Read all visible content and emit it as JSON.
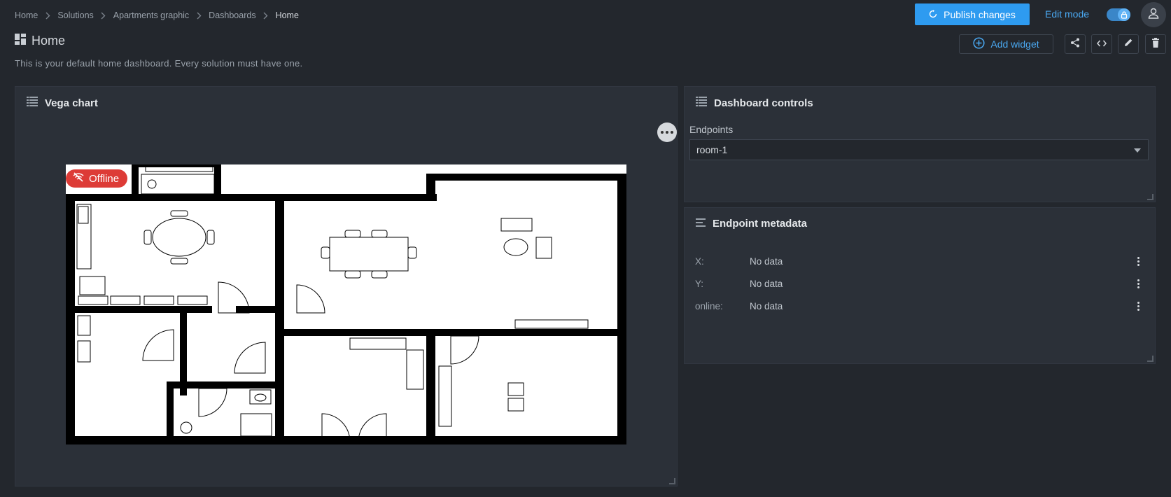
{
  "breadcrumb": [
    "Home",
    "Solutions",
    "Apartments graphic",
    "Dashboards",
    "Home"
  ],
  "header": {
    "publish_label": "Publish changes",
    "edit_mode_label": "Edit mode",
    "edit_mode_on": true
  },
  "page": {
    "title": "Home",
    "description": "This is your default home dashboard. Every solution must have one."
  },
  "toolbar": {
    "add_widget_label": "Add widget",
    "actions": [
      "share-icon",
      "code-icon",
      "pencil-icon",
      "trash-icon"
    ]
  },
  "widgets": {
    "vega": {
      "title": "Vega chart",
      "status_badge": "Offline"
    },
    "controls": {
      "title": "Dashboard controls",
      "endpoints_label": "Endpoints",
      "endpoint_value": "room-1"
    },
    "metadata": {
      "title": "Endpoint metadata",
      "rows": [
        {
          "key": "X:",
          "value": "No data"
        },
        {
          "key": "Y:",
          "value": "No data"
        },
        {
          "key": "online:",
          "value": "No data"
        }
      ]
    }
  },
  "colors": {
    "background": "#23272d",
    "panel": "#2b3038",
    "accent": "#2e9bf0",
    "offline": "#dd3b36"
  }
}
